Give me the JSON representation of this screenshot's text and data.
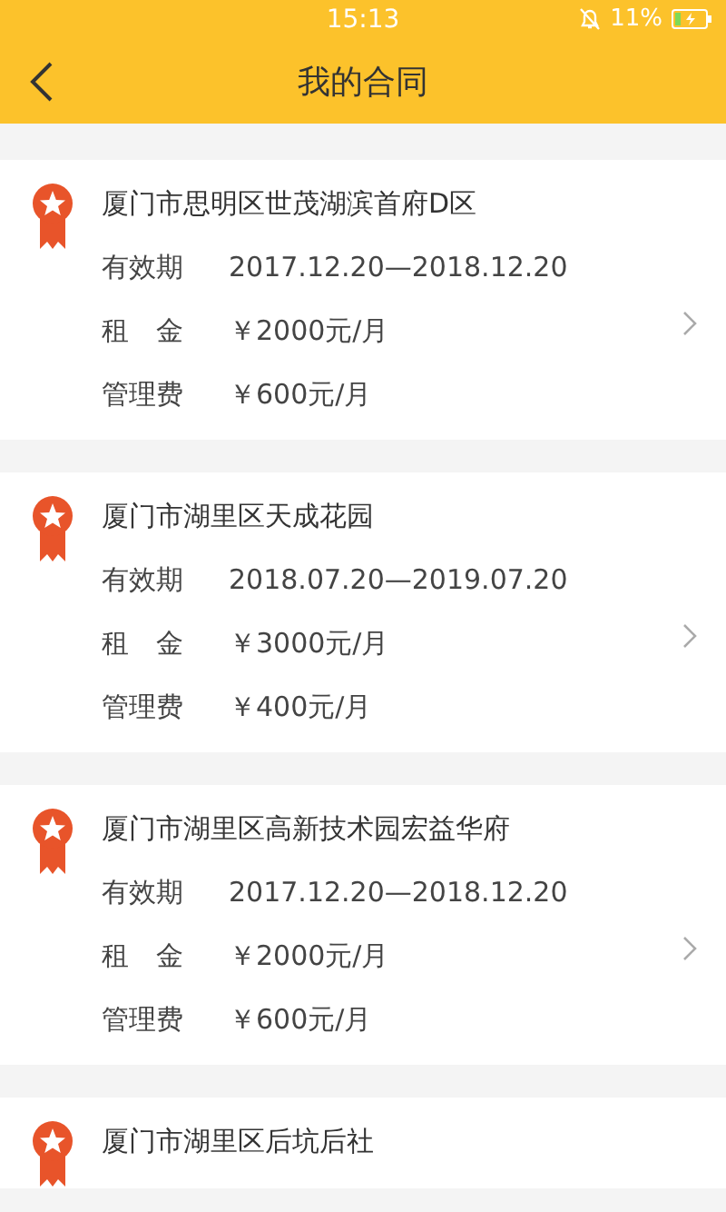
{
  "status_bar": {
    "time": "15:13",
    "battery": "11%"
  },
  "header": {
    "title": "我的合同"
  },
  "contracts": [
    {
      "address": "厦门市思明区世茂湖滨首府D区",
      "fields": [
        {
          "label": "有效期",
          "value": "2017.12.20—2018.12.20"
        },
        {
          "label": "租　金",
          "value": "￥2000元/月"
        },
        {
          "label": "管理费",
          "value": "￥600元/月"
        }
      ]
    },
    {
      "address": "厦门市湖里区天成花园",
      "fields": [
        {
          "label": "有效期",
          "value": "2018.07.20—2019.07.20"
        },
        {
          "label": "租　金",
          "value": "￥3000元/月"
        },
        {
          "label": "管理费",
          "value": "￥400元/月"
        }
      ]
    },
    {
      "address": "厦门市湖里区高新技术园宏益华府",
      "fields": [
        {
          "label": "有效期",
          "value": "2017.12.20—2018.12.20"
        },
        {
          "label": "租　金",
          "value": "￥2000元/月"
        },
        {
          "label": "管理费",
          "value": "￥600元/月"
        }
      ]
    },
    {
      "address": "厦门市湖里区后坑后社"
    }
  ]
}
